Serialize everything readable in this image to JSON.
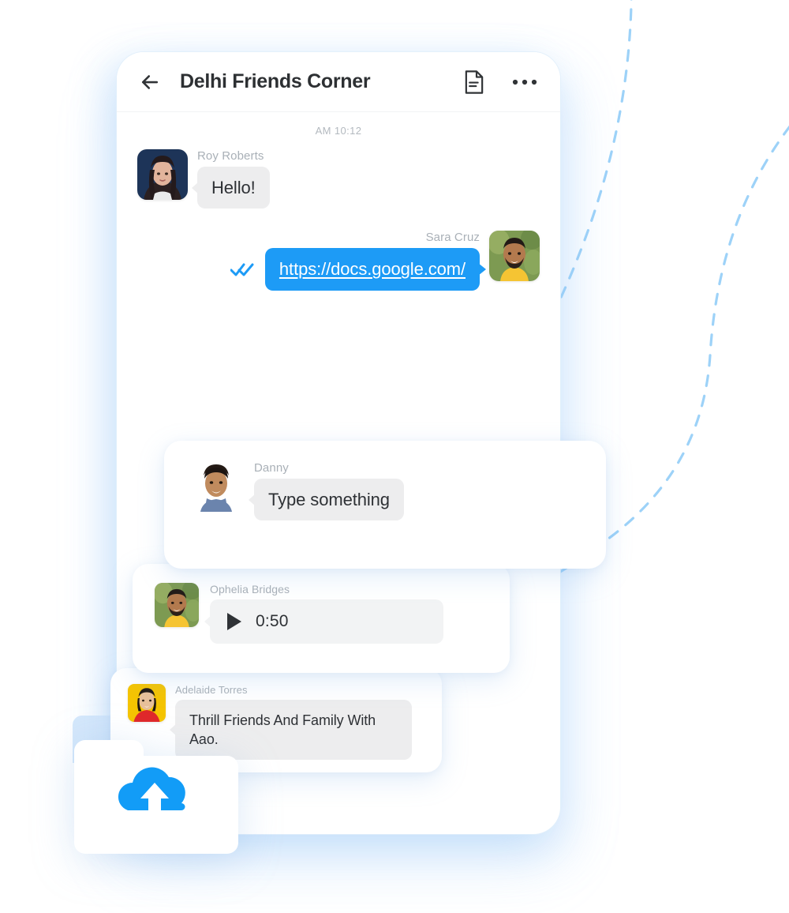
{
  "theme": {
    "accent_blue": "#1d9bf6",
    "bubble_gray": "#ededee",
    "title_color": "#2d3033",
    "sender_color": "#a9b0b7",
    "decor_dash_color": "#9dd2f8"
  },
  "header": {
    "back_icon": "arrow-left-icon",
    "title": "Delhi Friends Corner",
    "document_icon": "document-icon",
    "menu_icon": "more-options-icon"
  },
  "chat": {
    "timestamp": "AM 10:12",
    "messages": [
      {
        "id": "msg-hello",
        "sender": "Roy Roberts",
        "text": "Hello!",
        "direction": "incoming",
        "avatar": "avatar-roy-roberts"
      },
      {
        "id": "msg-link",
        "sender": "Sara Cruz",
        "text": "https://docs.google.com/",
        "direction": "outgoing",
        "status_icon": "double-check-icon",
        "avatar": "avatar-sara-cruz"
      }
    ]
  },
  "floating_cards": [
    {
      "id": "card-danny",
      "sender": "Danny",
      "text": "Type something",
      "avatar": "avatar-danny",
      "type": "text"
    },
    {
      "id": "card-ophelia",
      "sender": "Ophelia Bridges",
      "duration": "0:50",
      "avatar": "avatar-ophelia-bridges",
      "type": "audio",
      "play_icon": "play-icon"
    },
    {
      "id": "card-adelaide",
      "sender": "Adelaide Torres",
      "text": "Thrill Friends And Family With Aao.",
      "avatar": "avatar-adelaide-torres",
      "type": "text"
    }
  ],
  "folder": {
    "icon": "cloud-upload-icon",
    "label": ""
  }
}
